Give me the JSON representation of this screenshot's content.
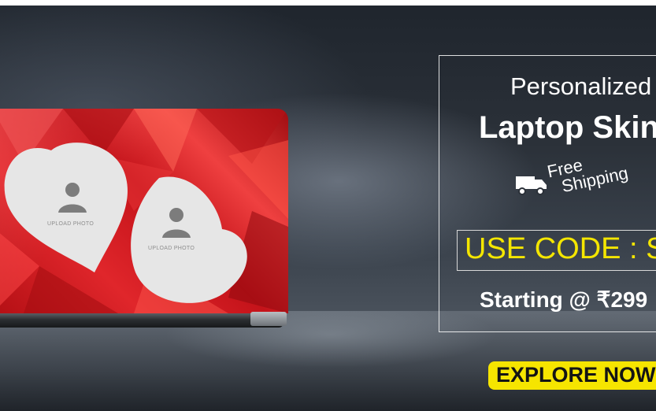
{
  "banner": {
    "title_line1": "Personalized",
    "title_line2": "Laptop Skin",
    "free_shipping_line1": "Free",
    "free_shipping_line2": "Shipping",
    "code_label": "USE CODE : SI",
    "price_label": "Starting @ ₹299",
    "cta_label": "EXPLORE NOW !",
    "upload_label_left": "UPLOAD PHOTO",
    "upload_label_right": "UPLOAD PHOTO"
  },
  "icons": {
    "truck": "truck-icon",
    "avatar": "user-avatar-icon"
  },
  "colors": {
    "accent_yellow": "#f6e500",
    "skin_red": "#d81d23",
    "background_dark": "#2b3139"
  }
}
